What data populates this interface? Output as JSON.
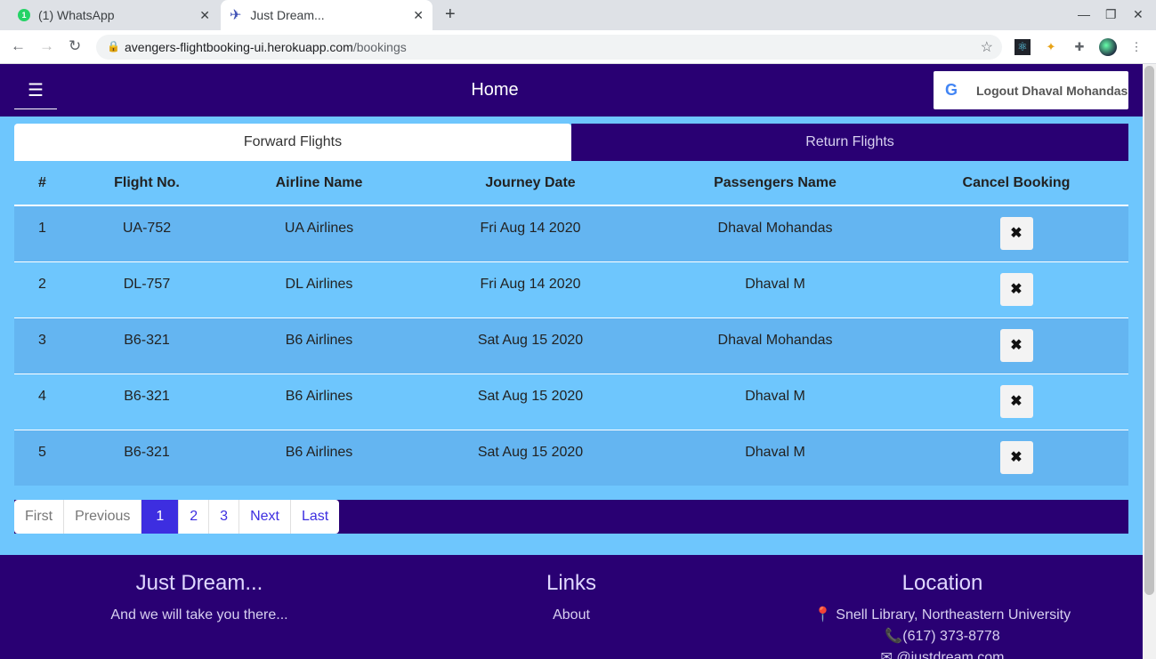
{
  "browser": {
    "tabs": [
      {
        "title": "(1) WhatsApp",
        "badge": "1"
      },
      {
        "title": "Just Dream..."
      }
    ],
    "url_host": "avengers-flightbooking-ui.herokuapp.com",
    "url_path": "/bookings"
  },
  "header": {
    "title": "Home",
    "logout_label": "Logout Dhaval Mohandas"
  },
  "flight_tabs": [
    "Forward Flights",
    "Return Flights"
  ],
  "table": {
    "headers": [
      "#",
      "Flight No.",
      "Airline Name",
      "Journey Date",
      "Passengers Name",
      "Cancel Booking"
    ],
    "rows": [
      {
        "num": "1",
        "flight": "UA-752",
        "airline": "UA Airlines",
        "date": "Fri Aug 14 2020",
        "passenger": "Dhaval Mohandas"
      },
      {
        "num": "2",
        "flight": "DL-757",
        "airline": "DL Airlines",
        "date": "Fri Aug 14 2020",
        "passenger": "Dhaval M"
      },
      {
        "num": "3",
        "flight": "B6-321",
        "airline": "B6 Airlines",
        "date": "Sat Aug 15 2020",
        "passenger": "Dhaval Mohandas"
      },
      {
        "num": "4",
        "flight": "B6-321",
        "airline": "B6 Airlines",
        "date": "Sat Aug 15 2020",
        "passenger": "Dhaval M"
      },
      {
        "num": "5",
        "flight": "B6-321",
        "airline": "B6 Airlines",
        "date": "Sat Aug 15 2020",
        "passenger": "Dhaval M"
      }
    ],
    "cancel_glyph": "✖"
  },
  "pagination": {
    "first": "First",
    "previous": "Previous",
    "pages": [
      "1",
      "2",
      "3"
    ],
    "active_page": "1",
    "next": "Next",
    "last": "Last"
  },
  "footer": {
    "brand": {
      "title": "Just Dream...",
      "tagline": "And we will take you there..."
    },
    "links": {
      "title": "Links",
      "about": "About"
    },
    "location": {
      "title": "Location",
      "address": "Snell Library, Northeastern University",
      "phone": "(617) 373-8778",
      "email": "@justdream.com"
    }
  },
  "colors": {
    "header_bg": "#290073",
    "page_bg": "#6ec6fd",
    "accent": "#3d2ee0"
  }
}
